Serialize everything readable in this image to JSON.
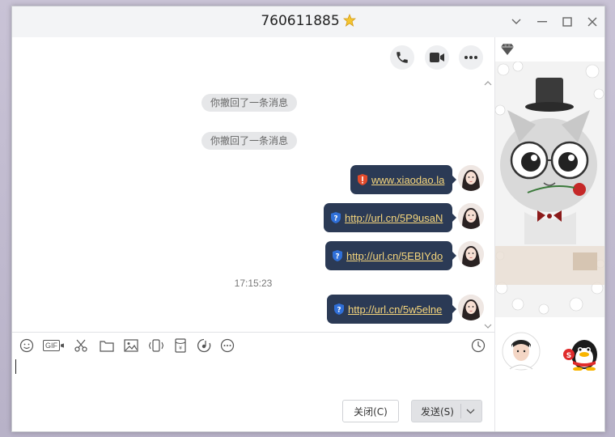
{
  "window": {
    "title": "760611885",
    "title_icon": "star-icon",
    "accent": "#2b3a55",
    "link_color": "#f6d67c"
  },
  "chat": {
    "system_messages": [
      "你撤回了一条消息",
      "你撤回了一条消息"
    ],
    "messages": [
      {
        "text": "www.xiaodao.la",
        "status_icon": "warning-shield-icon",
        "status_color": "#e24a2b"
      },
      {
        "text": "http://url.cn/5P9usaN",
        "status_icon": "question-shield-icon",
        "status_color": "#2f6fd8"
      },
      {
        "text": "http://url.cn/5EBIYdo",
        "status_icon": "question-shield-icon",
        "status_color": "#2f6fd8"
      },
      {
        "text": "http://url.cn/5w5elne",
        "status_icon": "question-shield-icon",
        "status_color": "#2f6fd8"
      }
    ],
    "timestamp": "17:15:23"
  },
  "toolbar": {
    "gif_label": "GIF"
  },
  "buttons": {
    "close_label": "关闭(C)",
    "send_label": "发送(S)"
  }
}
